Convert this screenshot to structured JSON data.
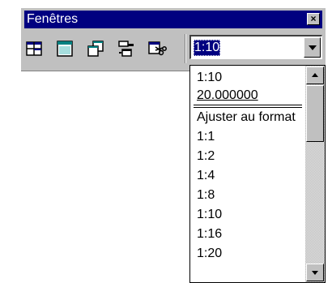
{
  "window": {
    "title": "Fenêtres",
    "close_label": "×"
  },
  "toolbar": {
    "buttons": [
      {
        "icon": "tile-windows-icon"
      },
      {
        "icon": "single-window-icon"
      },
      {
        "icon": "cascade-windows-icon"
      },
      {
        "icon": "arrange-windows-icon"
      },
      {
        "icon": "cut-window-icon"
      }
    ]
  },
  "zoom_combo": {
    "value": "1:10"
  },
  "dropdown": {
    "items": [
      "1:10",
      "20.000000",
      "Ajuster au format",
      "1:1",
      "1:2",
      "1:4",
      "1:8",
      "1:10",
      "1:16",
      "1:20"
    ]
  },
  "colors": {
    "titlebar": "#000080",
    "face": "#c0c0c0",
    "selection": "#000080"
  }
}
